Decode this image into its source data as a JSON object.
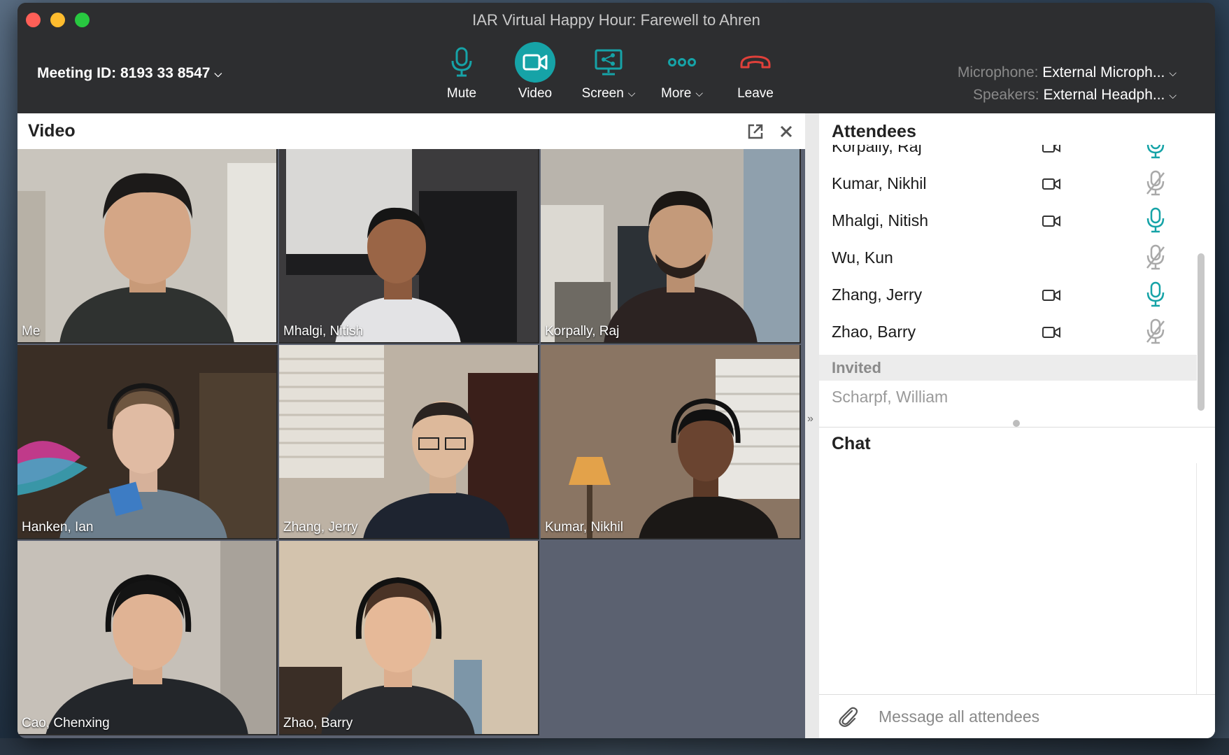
{
  "window": {
    "title": "IAR Virtual Happy Hour: Farewell to Ahren"
  },
  "toolbar": {
    "meeting_id": "Meeting ID: 8193 33 8547",
    "mute_label": "Mute",
    "video_label": "Video",
    "screen_label": "Screen",
    "more_label": "More",
    "leave_label": "Leave",
    "microphone_key": "Microphone:",
    "microphone_value": "External Microph...",
    "speakers_key": "Speakers:",
    "speakers_value": "External Headph...",
    "accent_color": "#16a3a7",
    "leave_color": "#e0403a"
  },
  "video_panel": {
    "title": "Video",
    "tiles": [
      {
        "name": "Me"
      },
      {
        "name": "Mhalgi, Nitish"
      },
      {
        "name": "Korpally, Raj"
      },
      {
        "name": "Hanken, Ian"
      },
      {
        "name": "Zhang, Jerry"
      },
      {
        "name": "Kumar, Nikhil"
      },
      {
        "name": "Cao, Chenxing"
      },
      {
        "name": "Zhao, Barry"
      }
    ]
  },
  "attendees": {
    "title": "Attendees",
    "list": [
      {
        "name": "Korpally, Raj",
        "camera": true,
        "mic": "active"
      },
      {
        "name": "Kumar, Nikhil",
        "camera": true,
        "mic": "muted"
      },
      {
        "name": "Mhalgi, Nitish",
        "camera": true,
        "mic": "active"
      },
      {
        "name": "Wu, Kun",
        "camera": false,
        "mic": "muted"
      },
      {
        "name": "Zhang, Jerry",
        "camera": true,
        "mic": "active"
      },
      {
        "name": "Zhao, Barry",
        "camera": true,
        "mic": "muted"
      }
    ],
    "invited_header": "Invited",
    "invited": [
      {
        "name": "Scharpf, William"
      }
    ]
  },
  "chat": {
    "title": "Chat",
    "input_placeholder": "Message all attendees"
  }
}
